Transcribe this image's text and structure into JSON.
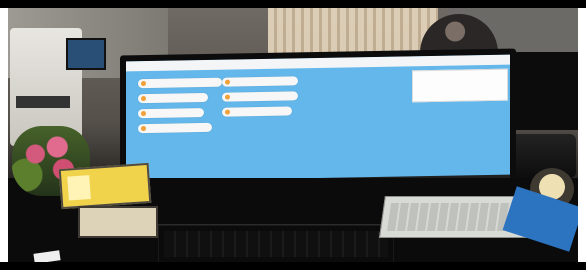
{
  "scene": {
    "kind": "photo",
    "main_display": {
      "app_title": "",
      "buttons": [
        {
          "label": ""
        },
        {
          "label": ""
        },
        {
          "label": ""
        },
        {
          "label": ""
        },
        {
          "label": ""
        },
        {
          "label": ""
        },
        {
          "label": ""
        }
      ],
      "notification": {
        "line1": "",
        "line2": ""
      }
    }
  },
  "colors": {
    "screen_bg": "#64b7ea",
    "button_bg": "#f7f7f7",
    "accent_dot": "#f2a13a"
  }
}
